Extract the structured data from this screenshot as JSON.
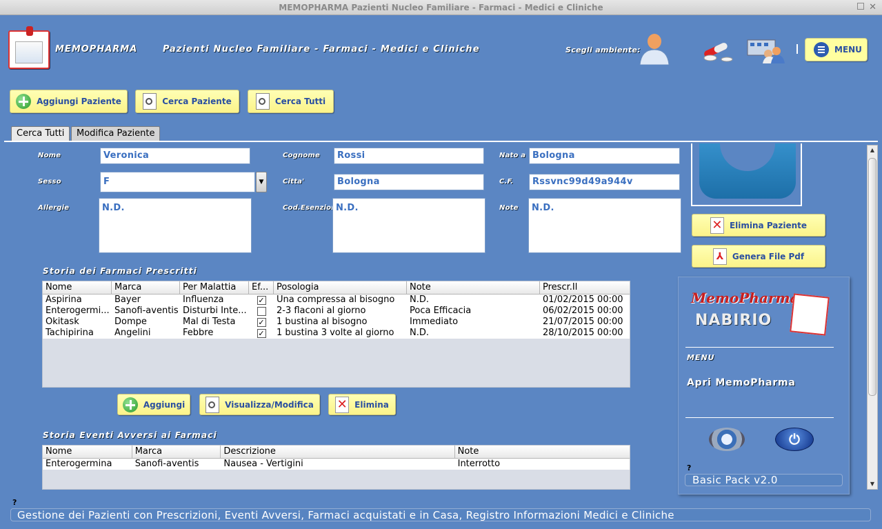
{
  "window": {
    "title": "MEMOPHARMA    Pazienti Nucleo Familiare - Farmaci - Medici e Cliniche"
  },
  "header": {
    "brand": "MEMOPHARMA",
    "title": "Pazienti Nucleo Familiare - Farmaci - Medici e Cliniche",
    "env_label": "Scegli ambiente:",
    "menu_label": "MENU"
  },
  "toolbar": {
    "add_patient": "Aggiungi Paziente",
    "search_patient": "Cerca Paziente",
    "search_all": "Cerca Tutti"
  },
  "tabs": [
    {
      "label": "Cerca Tutti"
    },
    {
      "label": "Modifica Paziente"
    }
  ],
  "patient": {
    "labels": {
      "nome": "Nome",
      "cognome": "Cognome",
      "nato_a": "Nato a",
      "sesso": "Sesso",
      "citta": "Citta'",
      "cf": "C.F.",
      "allergie": "Allergie",
      "esenzioni": "Cod.Esenzioni",
      "note": "Note"
    },
    "nome": "Veronica",
    "cognome": "Rossi",
    "nato_a": "Bologna",
    "sesso": "F",
    "citta": "Bologna",
    "cf": "Rssvnc99d49a944v",
    "allergie": "N.D.",
    "esenzioni": "N.D.",
    "note": "N.D."
  },
  "side_actions": {
    "delete_patient": "Elimina Paziente",
    "generate_pdf": "Genera File Pdf"
  },
  "prescriptions": {
    "title": "Storia dei Farmaci Prescritti",
    "columns": [
      "Nome",
      "Marca",
      "Per Malattia",
      "Ef...",
      "Posologia",
      "Note",
      "Prescr.Il"
    ],
    "rows": [
      {
        "nome": "Aspirina",
        "marca": "Bayer",
        "malattia": "Influenza",
        "ef": true,
        "posologia": "Una compressa al bisogno",
        "note": "N.D.",
        "data": "01/02/2015 00:00"
      },
      {
        "nome": "Enterogermi...",
        "marca": "Sanofi-aventis",
        "malattia": "Disturbi Inte...",
        "ef": false,
        "posologia": "2-3 flaconi al giorno",
        "note": "Poca Efficacia",
        "data": "06/02/2015 00:00"
      },
      {
        "nome": "Okitask",
        "marca": "Dompe",
        "malattia": "Mal di Testa",
        "ef": true,
        "posologia": "1 bustina al bisogno",
        "note": "Immediato",
        "data": "21/07/2015 00:00"
      },
      {
        "nome": "Tachipirina",
        "marca": "Angelini",
        "malattia": "Febbre",
        "ef": true,
        "posologia": "1 bustina 3 volte al giorno",
        "note": "N.D.",
        "data": "28/10/2015 00:00"
      }
    ],
    "buttons": {
      "add": "Aggiungi",
      "view_edit": "Visualizza/Modifica",
      "delete": "Elimina"
    }
  },
  "adverse_events": {
    "title": "Storia Eventi Avversi ai Farmaci",
    "columns": [
      "Nome",
      "Marca",
      "Descrizione",
      "Note"
    ],
    "rows": [
      {
        "nome": "Enterogermina",
        "marca": "Sanofi-aventis",
        "descrizione": "Nausea - Vertigini",
        "note": "Interrotto"
      }
    ]
  },
  "right_panel": {
    "logo_text": "MemoPharma",
    "logo_sub": "NABIRIO",
    "menu_title": "MENU",
    "open_link": "Apri MemoPharma",
    "help": "?",
    "version": "Basic Pack v2.0"
  },
  "footer": {
    "help": "?",
    "status": "Gestione dei Pazienti con Prescrizioni, Eventi Avversi, Farmaci acquistati e in Casa, Registro Informazioni Medici e Cliniche"
  },
  "colors": {
    "background": "#5b86c3",
    "button": "#ffffa0",
    "accent_text": "#2a4fa0"
  }
}
